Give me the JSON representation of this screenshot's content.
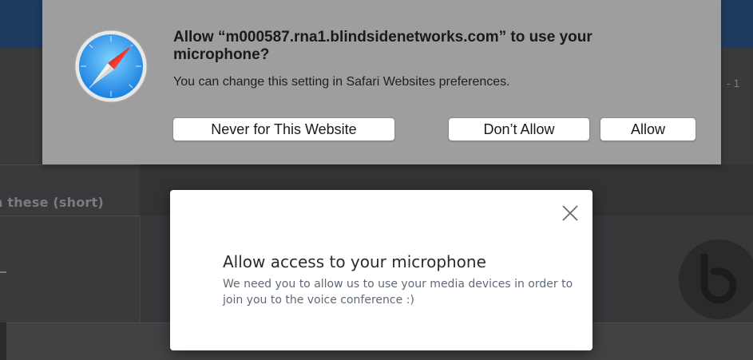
{
  "background": {
    "left_panel_text": "n these (short)",
    "right_edge_text": "- 1"
  },
  "safari_prompt": {
    "icon": "safari-compass-icon",
    "title": "Allow “m000587.rna1.blindsidenetworks.com” to use your microphone?",
    "subtitle": "You can change this setting in Safari Websites preferences.",
    "buttons": {
      "never": "Never for This Website",
      "dont_allow": "Don’t Allow",
      "allow": "Allow"
    }
  },
  "modal": {
    "close_icon": "close-icon",
    "title": "Allow access to your microphone",
    "description": "We need you to allow us to use your media devices in order to join you to the voice conference :)"
  },
  "colors": {
    "sheet_background": "#9e9e9e",
    "modal_background": "#ffffff",
    "app_background": "#2c2c2e",
    "top_bar": "#1f3a5f"
  }
}
